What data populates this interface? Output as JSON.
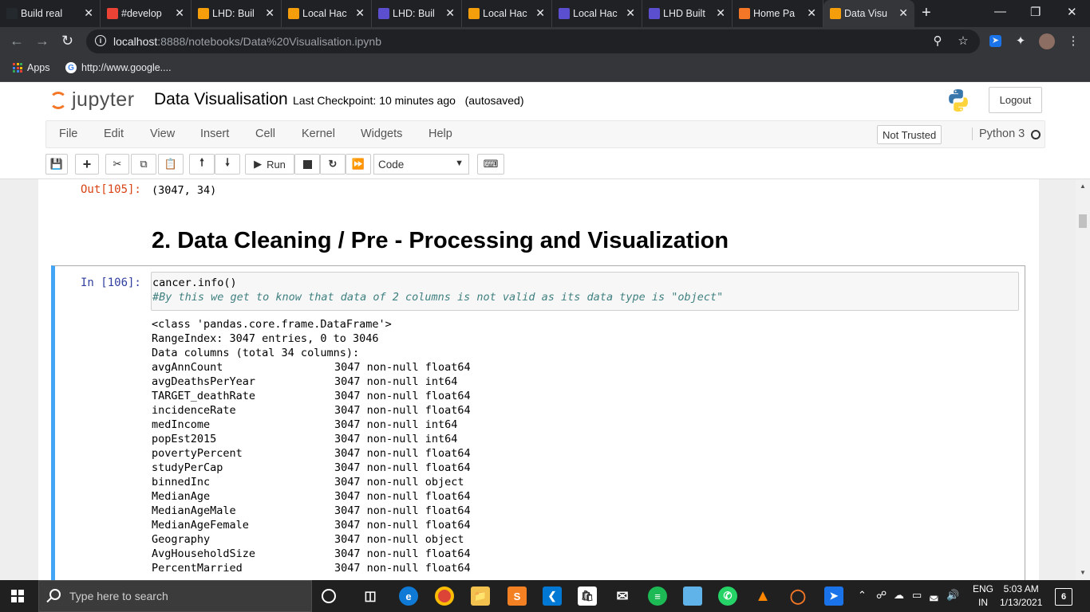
{
  "browser": {
    "tabs": [
      {
        "title": "Build real",
        "icon": "github-icon",
        "color": "#24292e"
      },
      {
        "title": "#develop",
        "icon": "calendar-icon",
        "color": "#ea4335"
      },
      {
        "title": "LHD: Buil",
        "icon": "lhd-icon",
        "color": "#f59e0b"
      },
      {
        "title": "Local Hac",
        "icon": "lhd-icon",
        "color": "#f59e0b"
      },
      {
        "title": "LHD: Buil",
        "icon": "devpost-icon",
        "color": "#5b4fcf"
      },
      {
        "title": "Local Hac",
        "icon": "lhd-icon",
        "color": "#f59e0b"
      },
      {
        "title": "Local Hac",
        "icon": "devpost-icon",
        "color": "#5b4fcf"
      },
      {
        "title": "LHD Built",
        "icon": "devpost-icon",
        "color": "#5b4fcf"
      },
      {
        "title": "Home Pa",
        "icon": "jupyter-icon",
        "color": "#f37726"
      },
      {
        "title": "Data Visu",
        "icon": "notebook-icon",
        "color": "#f59e0b"
      }
    ],
    "url_host": "localhost",
    "url_path": ":8888/notebooks/Data%20Visualisation.ipynb",
    "bookmarks": {
      "apps": "Apps",
      "google": "http://www.google...."
    }
  },
  "jupyter": {
    "logo_text": "jupyter",
    "notebook_name": "Data Visualisation",
    "checkpoint": "Last Checkpoint: 10 minutes ago",
    "autosaved": "(autosaved)",
    "logout": "Logout",
    "menu": [
      "File",
      "Edit",
      "View",
      "Insert",
      "Cell",
      "Kernel",
      "Widgets",
      "Help"
    ],
    "trust": "Not Trusted",
    "kernel": "Python 3",
    "toolbar": {
      "run": "Run",
      "cell_type": "Code"
    }
  },
  "notebook": {
    "out_prompt_105": "Out[105]:",
    "out_value_105": "(3047, 34)",
    "heading": "2. Data Cleaning / Pre - Processing and Visualization",
    "in_prompt_106": "In [106]:",
    "code_line1": "cancer.info()",
    "code_line2": "#By this we get to know that data of 2 columns is not valid as its data type is \"object\"",
    "output_header": [
      "<class 'pandas.core.frame.DataFrame'>",
      "RangeIndex: 3047 entries, 0 to 3046",
      "Data columns (total 34 columns):"
    ],
    "columns": [
      {
        "name": "avgAnnCount",
        "info": "3047 non-null float64"
      },
      {
        "name": "avgDeathsPerYear",
        "info": "3047 non-null int64"
      },
      {
        "name": "TARGET_deathRate",
        "info": "3047 non-null float64"
      },
      {
        "name": "incidenceRate",
        "info": "3047 non-null float64"
      },
      {
        "name": "medIncome",
        "info": "3047 non-null int64"
      },
      {
        "name": "popEst2015",
        "info": "3047 non-null int64"
      },
      {
        "name": "povertyPercent",
        "info": "3047 non-null float64"
      },
      {
        "name": "studyPerCap",
        "info": "3047 non-null float64"
      },
      {
        "name": "binnedInc",
        "info": "3047 non-null object"
      },
      {
        "name": "MedianAge",
        "info": "3047 non-null float64"
      },
      {
        "name": "MedianAgeMale",
        "info": "3047 non-null float64"
      },
      {
        "name": "MedianAgeFemale",
        "info": "3047 non-null float64"
      },
      {
        "name": "Geography",
        "info": "3047 non-null object"
      },
      {
        "name": "AvgHouseholdSize",
        "info": "3047 non-null float64"
      },
      {
        "name": "PercentMarried",
        "info": "3047 non-null float64"
      }
    ]
  },
  "taskbar": {
    "search_placeholder": "Type here to search",
    "lang_line1": "ENG",
    "lang_line2": "IN",
    "time": "5:03 AM",
    "date": "1/13/2021",
    "notifications": "6"
  }
}
